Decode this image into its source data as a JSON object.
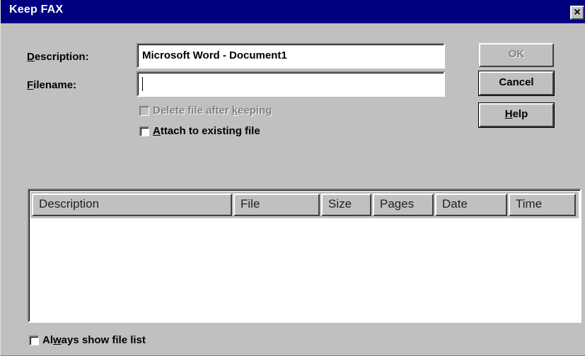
{
  "window": {
    "title": "Keep FAX",
    "close_glyph": "×"
  },
  "form": {
    "description_label_u": "D",
    "description_label_rest": "escription:",
    "description_value": "Microsoft Word - Document1",
    "filename_label_u": "F",
    "filename_label_rest": "ilename:",
    "filename_value": ""
  },
  "options": {
    "delete_after_pre": "Delete file after ",
    "delete_after_u": "k",
    "delete_after_post": "eeping",
    "delete_after_checked": false,
    "delete_after_enabled": false,
    "attach_u": "A",
    "attach_rest": "ttach to existing file",
    "attach_checked": false
  },
  "buttons": {
    "ok": "OK",
    "cancel": "Cancel",
    "help_u": "H",
    "help_rest": "elp"
  },
  "file_list": {
    "columns": [
      "Description",
      "File",
      "Size",
      "Pages",
      "Date",
      "Time"
    ],
    "rows": []
  },
  "footer": {
    "always_show_pre": "Al",
    "always_show_u": "w",
    "always_show_post": "ays show file list",
    "always_show_checked": false
  }
}
